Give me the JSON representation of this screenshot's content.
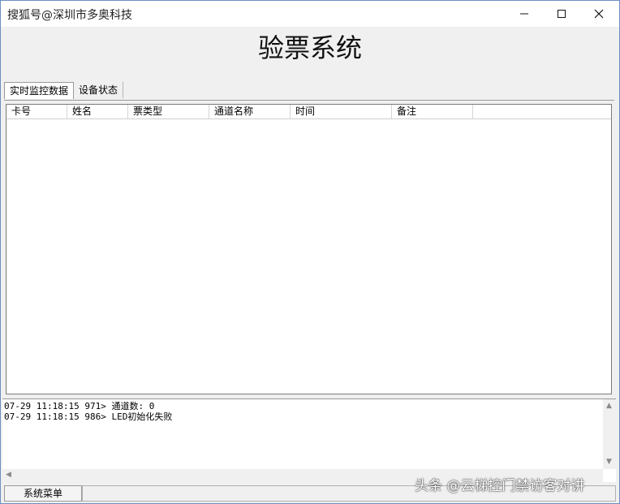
{
  "window": {
    "title": "搜狐号@深圳市多奥科技"
  },
  "app": {
    "heading": "验票系统"
  },
  "tabs": [
    {
      "label": "实时监控数据",
      "active": true
    },
    {
      "label": "设备状态",
      "active": false
    }
  ],
  "table": {
    "columns": [
      "卡号",
      "姓名",
      "票类型",
      "通道名称",
      "时间",
      "备注"
    ],
    "rows": []
  },
  "log": {
    "lines": [
      "07-29 11:18:15 971> 通道数: 0",
      "07-29 11:18:15 986> LED初始化失败"
    ]
  },
  "statusbar": {
    "menu_label": "系统菜单"
  },
  "watermark": {
    "text": "头条 @云梯控门禁访客对讲"
  }
}
